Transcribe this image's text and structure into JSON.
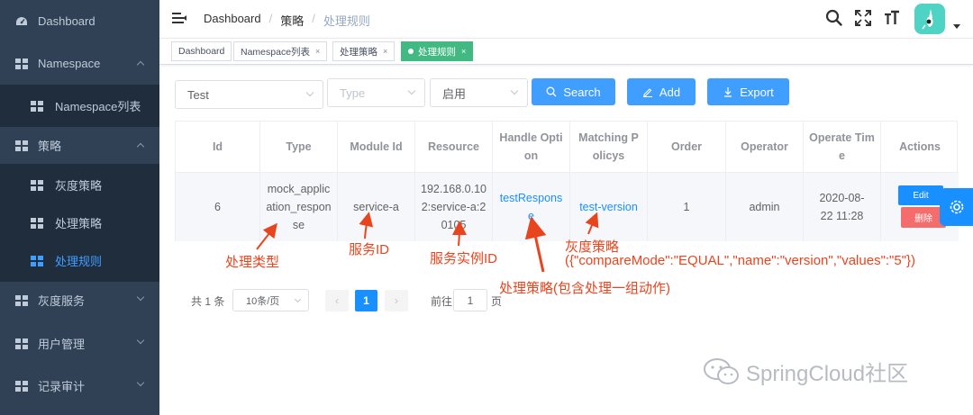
{
  "sidebar": {
    "items": [
      {
        "label": "Dashboard",
        "icon": "dashboard-icon"
      },
      {
        "label": "Namespace",
        "icon": "grid-icon",
        "expanded": true
      },
      {
        "label": "Namespace列表",
        "icon": "grid-icon",
        "sub": true
      },
      {
        "label": "策略",
        "icon": "grid-icon",
        "expanded": true
      },
      {
        "label": "灰度策略",
        "icon": "grid-icon",
        "sub": true
      },
      {
        "label": "处理策略",
        "icon": "grid-icon",
        "sub": true
      },
      {
        "label": "处理规则",
        "icon": "grid-icon",
        "sub": true,
        "active": true
      },
      {
        "label": "灰度服务",
        "icon": "grid-icon"
      },
      {
        "label": "用户管理",
        "icon": "grid-icon"
      },
      {
        "label": "记录审计",
        "icon": "grid-icon"
      }
    ]
  },
  "header": {
    "breadcrumb": [
      "Dashboard",
      "策略",
      "处理规则"
    ]
  },
  "tags": [
    {
      "label": "Dashboard"
    },
    {
      "label": "Namespace列表",
      "close": "×"
    },
    {
      "label": "处理策略",
      "close": "×"
    },
    {
      "label": "处理规则",
      "close": "×",
      "active": true
    }
  ],
  "filters": {
    "namespace_value": "Test",
    "type_placeholder": "Type",
    "status_value": "启用",
    "search_label": "Search",
    "add_label": "Add",
    "export_label": "Export"
  },
  "table": {
    "headers": [
      "Id",
      "Type",
      "Module Id",
      "Resource",
      "Handle Option",
      "Matching Policys",
      "Order",
      "Operator",
      "Operate Time",
      "Actions"
    ],
    "row": {
      "id": "6",
      "type": "mock_application_response",
      "module_id": "service-a",
      "resource": "192.168.0.102:service-a:20105",
      "handle_option": "testResponse",
      "matching_policys": "test-version",
      "order": "1",
      "operator": "admin",
      "operate_time": "2020-08-22 11:28",
      "edit_label": "Edit",
      "delete_label": "删除"
    }
  },
  "annotations": {
    "type": "处理类型",
    "service_id": "服务ID",
    "instance_id": "服务实例ID",
    "handle_policy": "处理策略(包含处理一组动作)",
    "gray_policy": "灰度策略",
    "gray_policy_detail": "({\"compareMode\":\"EQUAL\",\"name\":\"version\",\"values\":\"5\"})"
  },
  "pagination": {
    "total": "共 1 条",
    "page_size": "10条/页",
    "current_page": "1",
    "goto_label": "前往",
    "goto_value": "1",
    "page_suffix": "页"
  },
  "watermark": {
    "text": "SpringCloud社区"
  },
  "colors": {
    "sidebar_bg": "#304156",
    "primary": "#409eff",
    "link": "#1890ff",
    "tag_active": "#42b983",
    "danger": "#f56c6c",
    "annotation": "#e8451f"
  }
}
